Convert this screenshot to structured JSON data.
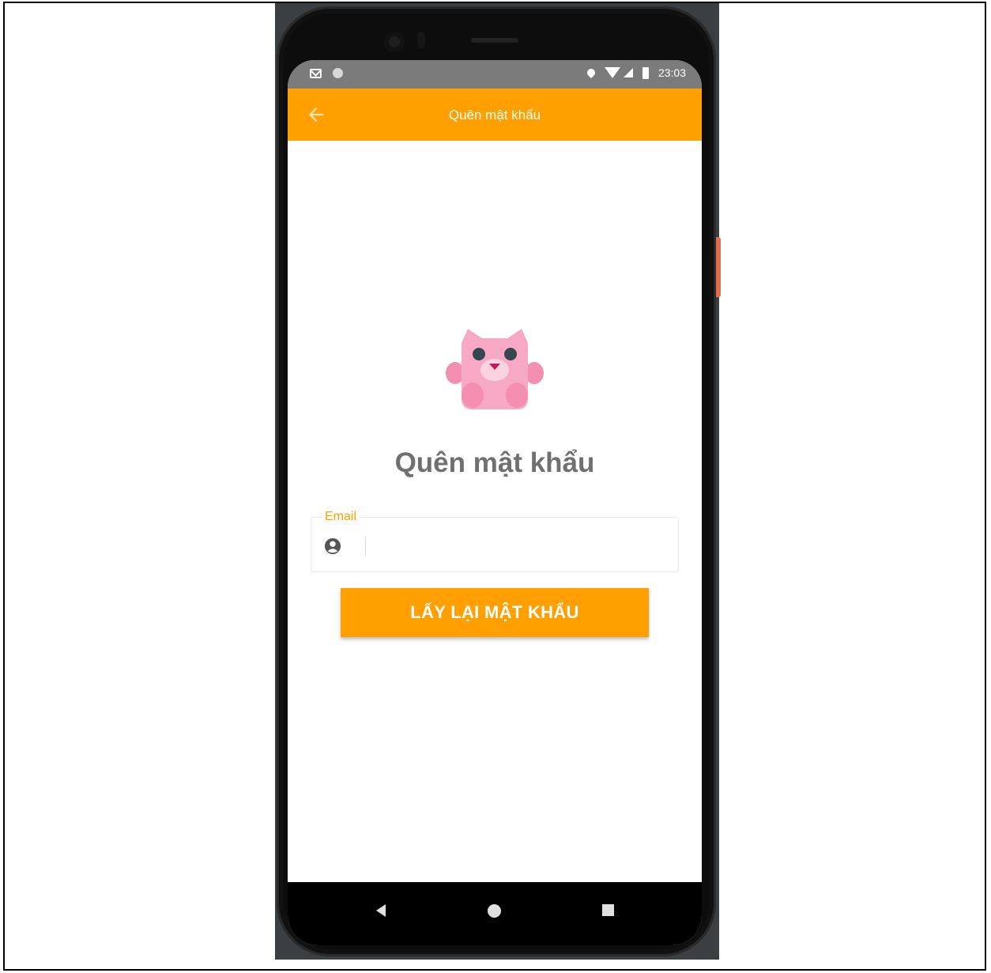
{
  "status_bar": {
    "time": "23:03"
  },
  "app_bar": {
    "title": "Quên mật khẩu"
  },
  "main": {
    "heading": "Quên mật khẩu",
    "email_field": {
      "label": "Email",
      "value": "",
      "placeholder": ""
    },
    "submit_button_label": "LẤY LẠI MẬT KHẨU"
  },
  "colors": {
    "accent": "#ffa000",
    "status_bar": "#7b7b7b",
    "heading": "#707070",
    "mascot": "#f7a8c4"
  },
  "icons": [
    "back-arrow-icon",
    "user-circle-icon",
    "mail-icon",
    "location-icon",
    "wifi-icon",
    "signal-icon",
    "battery-icon",
    "mascot-owl-icon"
  ]
}
